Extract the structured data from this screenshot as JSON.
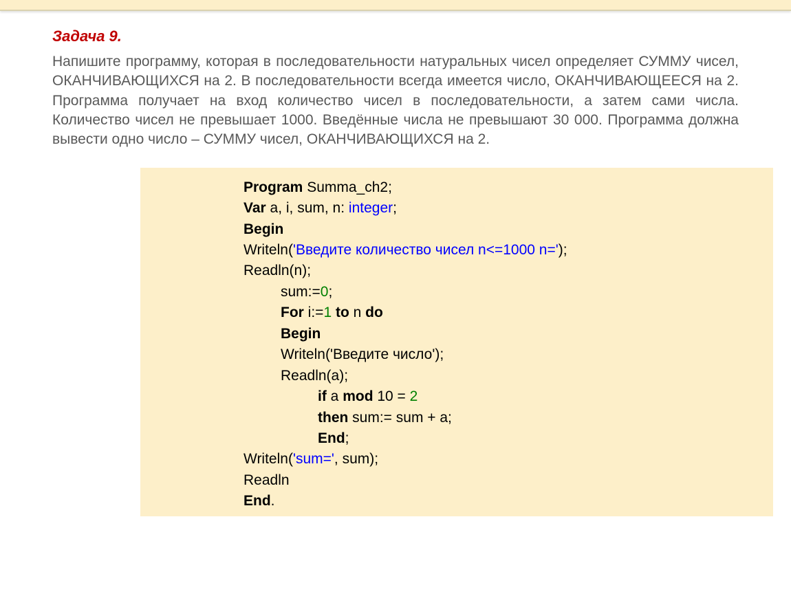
{
  "title": "Задача 9.",
  "problem": "Напишите программу, которая в последовательности натуральных чисел определяет СУММУ чисел, ОКАНЧИВАЮЩИХСЯ на 2. В последовательности всегда имеется число, ОКАНЧИВАЮЩЕЕСЯ на 2. Программа получает на вход количество чисел в последовательности, а затем сами числа. Количество чисел не превышает 1000. Введённые числа не превышают 30 000. Программа должна вывести одно число – СУММУ чисел, ОКАНЧИВАЮЩИХСЯ на 2.",
  "code": {
    "l1_kw": "Program",
    "l1_rest": " Summa_ch2;",
    "l2_kw": "Var",
    "l2_mid": " a, i, sum, n: ",
    "l2_type": "integer",
    "l2_end": ";",
    "l3": "Begin",
    "l4_a": "Writeln(",
    "l4_b": "'Введите количество чисел n<=1000 n='",
    "l4_c": ");",
    "l5": "Readln(n);",
    "l6_a": "sum:=",
    "l6_b": "0",
    "l6_c": ";",
    "l7_a": "For",
    "l7_b": " i:=",
    "l7_c": "1",
    "l7_d": " ",
    "l7_e": "to",
    "l7_f": " n ",
    "l7_g": "do",
    "l8": "Begin",
    "l9": "Writeln('Введите число');",
    "l10": "Readln(a);",
    "l11_a": "if",
    "l11_b": " a ",
    "l11_c": "mod",
    "l11_d": " 10 = ",
    "l11_e": "2",
    "l12_a": "then",
    "l12_b": " sum:= sum + a;",
    "l13_a": "End",
    "l13_b": ";",
    "l14_a": "Writeln(",
    "l14_b": "'sum='",
    "l14_c": ", sum);",
    "l15": "Readln",
    "l16_a": "End",
    "l16_b": "."
  }
}
